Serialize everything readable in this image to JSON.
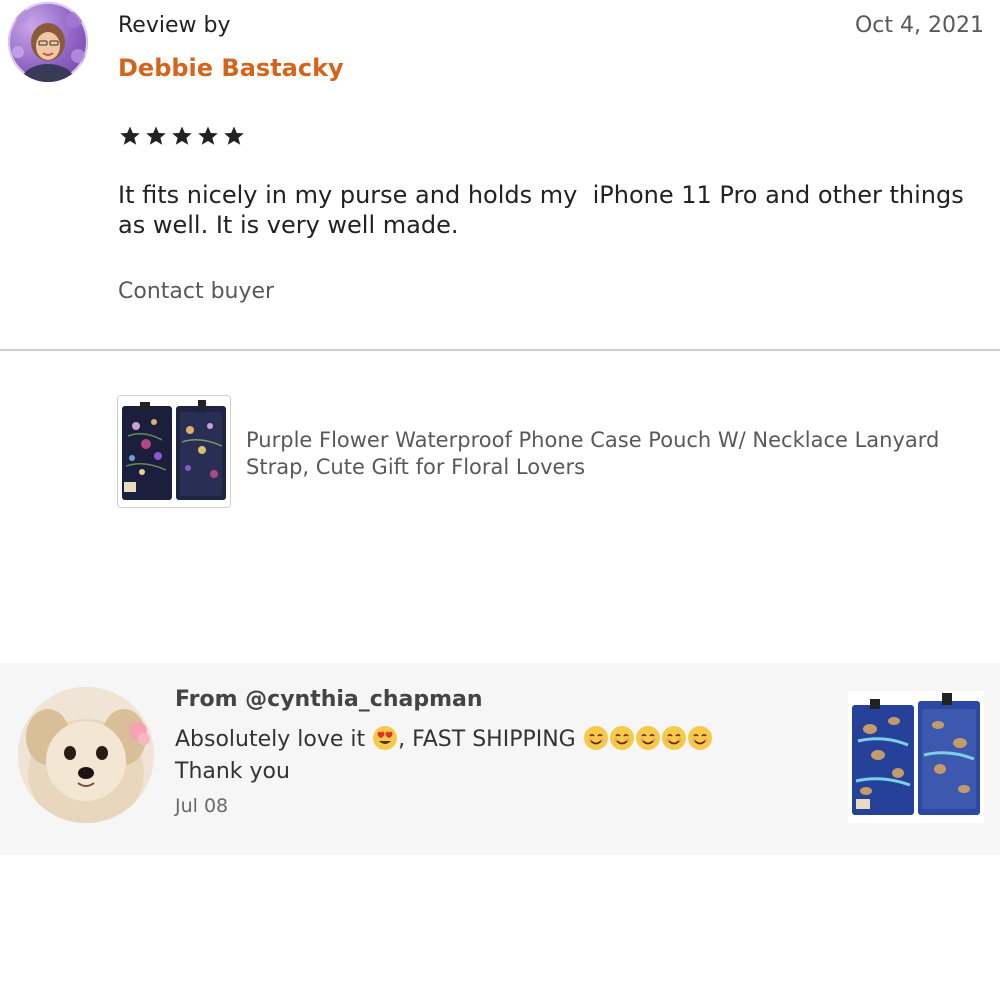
{
  "review": {
    "label": "Review by",
    "reviewer_name": "Debbie Bastacky",
    "date": "Oct 4, 2021",
    "rating": 5,
    "text": "It fits nicely in my purse and holds my  iPhone 11 Pro and other things as well. It is very well made.",
    "contact_label": "Contact buyer",
    "avatar_icon": "reviewer-avatar"
  },
  "product": {
    "title": "Purple Flower Waterproof Phone Case Pouch W/ Necklace Lanyard Strap, Cute Gift for Floral Lovers",
    "thumbnail_icon": "product-thumbnail"
  },
  "message": {
    "from": "From @cynthia_chapman",
    "text_part1": "Absolutely love it ",
    "text_part2": ", FAST SHIPPING ",
    "text_line2": "Thank you",
    "date": "Jul 08",
    "emoji_heart_eyes": "heart-eyes-emoji",
    "emoji_smile": "smiling-face-emoji",
    "smile_count": 5,
    "avatar_icon": "dog-avatar",
    "thumbnail_icon": "product-photo"
  },
  "colors": {
    "accent_orange": "#d5641c",
    "text_dark": "#222222",
    "text_muted": "#595959",
    "divider": "#cfcfcf",
    "message_bg": "#f6f6f6"
  }
}
